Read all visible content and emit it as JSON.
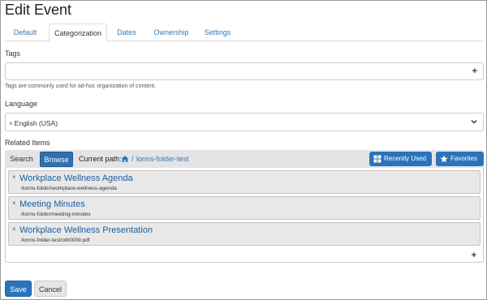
{
  "page": {
    "title": "Edit Event"
  },
  "tabs": [
    {
      "label": "Default"
    },
    {
      "label": "Categorization"
    },
    {
      "label": "Dates"
    },
    {
      "label": "Ownership"
    },
    {
      "label": "Settings"
    }
  ],
  "active_tab": "Categorization",
  "tags": {
    "label": "Tags",
    "value": "",
    "add_symbol": "+",
    "help": "Tags are commonly used for ad-hoc organization of content."
  },
  "language": {
    "label": "Language",
    "remove_symbol": "×",
    "value": "English (USA)"
  },
  "related": {
    "label": "Related Items",
    "search_label": "Search",
    "browse_label": "Browse",
    "current_path_label": "Current path:",
    "path_separator": "/",
    "path_link": "lonns-folder-test",
    "recently_used_label": "Recently Used",
    "favorites_label": "Favorites",
    "remove_symbol": "×",
    "add_symbol": "+",
    "items": [
      {
        "title": "Workplace Wellness Agenda",
        "path": "/lonns-folder/workplace-wellness-agenda"
      },
      {
        "title": "Meeting Minutes",
        "path": "/lonns-folder/meeting-minutes"
      },
      {
        "title": "Workplace Wellness Presentation",
        "path": "/lonns-folder-test/oth0009.pdf"
      }
    ]
  },
  "actions": {
    "save_label": "Save",
    "cancel_label": "Cancel"
  },
  "colors": {
    "primary": "#2a74bc",
    "link": "#337ab7",
    "item_bg": "#e8e8e8"
  }
}
